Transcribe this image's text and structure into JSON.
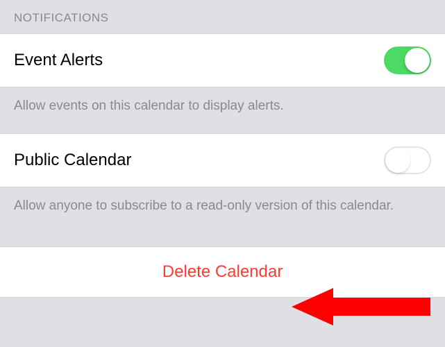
{
  "section_header": "NOTIFICATIONS",
  "event_alerts": {
    "label": "Event Alerts",
    "enabled": true,
    "footer": "Allow events on this calendar to display alerts."
  },
  "public_calendar": {
    "label": "Public Calendar",
    "enabled": false,
    "footer": "Allow anyone to subscribe to a read-only version of this calendar."
  },
  "delete_button": {
    "label": "Delete Calendar"
  },
  "colors": {
    "destructive": "#ff3b30",
    "toggle_on": "#4cd964",
    "background": "#e0dfe4"
  }
}
